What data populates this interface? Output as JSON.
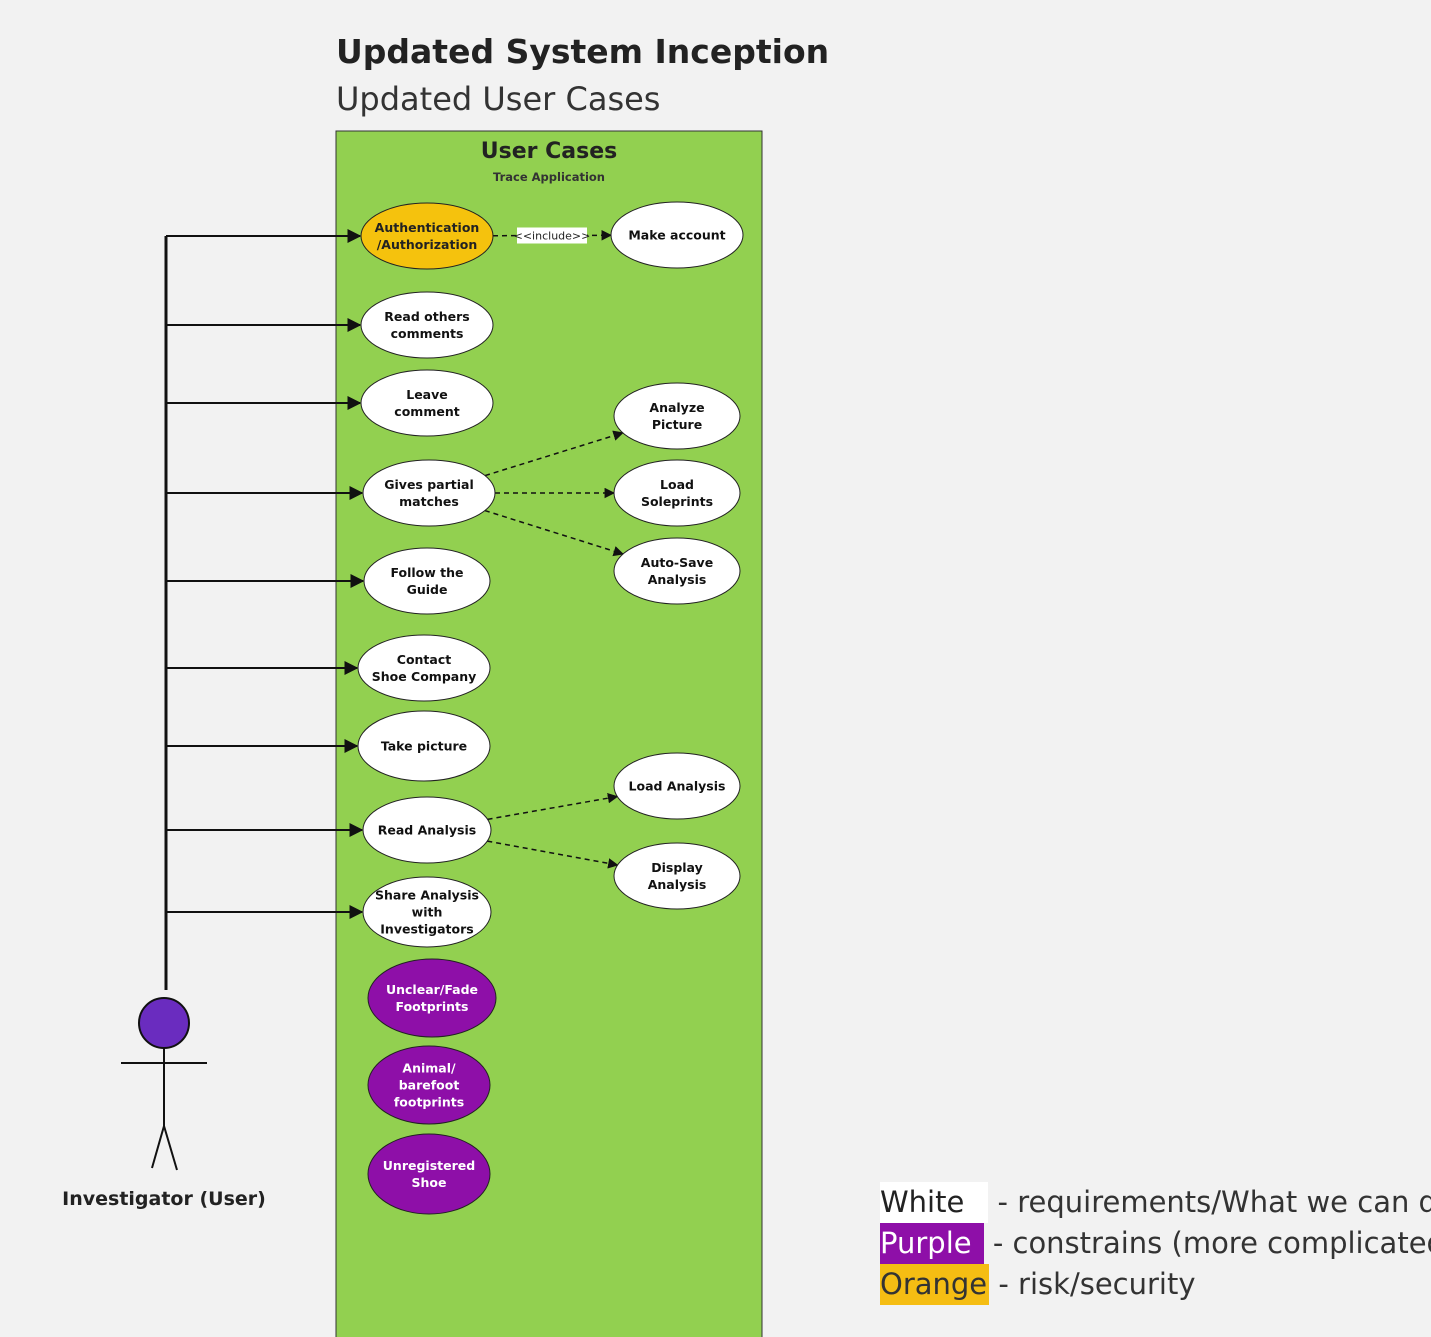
{
  "header": {
    "title": "Updated System Inception",
    "subtitle": "Updated User Cases"
  },
  "colors": {
    "background": "#f2f2f2",
    "system_boundary": "#92d050",
    "white_case": "#ffffff",
    "purple_case": "#8e0fa8",
    "orange_case": "#f5c20d",
    "actor_head": "#6a2cbf"
  },
  "system": {
    "title": "User Cases",
    "subtitle": "Trace Application"
  },
  "actor": {
    "label": "Investigator (User)",
    "icon": "stick-figure-icon"
  },
  "use_cases": [
    {
      "id": "auth",
      "lines": [
        "Authentication",
        "/Authorization"
      ],
      "color": "orange"
    },
    {
      "id": "make_account",
      "lines": [
        "Make account"
      ],
      "color": "white"
    },
    {
      "id": "read_comments",
      "lines": [
        "Read others",
        "comments"
      ],
      "color": "white"
    },
    {
      "id": "leave_comment",
      "lines": [
        "Leave",
        "comment"
      ],
      "color": "white"
    },
    {
      "id": "analyze_picture",
      "lines": [
        "Analyze",
        "Picture"
      ],
      "color": "white"
    },
    {
      "id": "partial_matches",
      "lines": [
        "Gives partial",
        "matches"
      ],
      "color": "white"
    },
    {
      "id": "load_soleprints",
      "lines": [
        "Load",
        "Soleprints"
      ],
      "color": "white"
    },
    {
      "id": "auto_save",
      "lines": [
        "Auto-Save",
        "Analysis"
      ],
      "color": "white"
    },
    {
      "id": "follow_guide",
      "lines": [
        "Follow the",
        "Guide"
      ],
      "color": "white"
    },
    {
      "id": "contact_company",
      "lines": [
        "Contact",
        "Shoe Company"
      ],
      "color": "white"
    },
    {
      "id": "take_picture",
      "lines": [
        "Take picture"
      ],
      "color": "white"
    },
    {
      "id": "load_analysis",
      "lines": [
        "Load Analysis"
      ],
      "color": "white"
    },
    {
      "id": "read_analysis",
      "lines": [
        "Read Analysis"
      ],
      "color": "white"
    },
    {
      "id": "display_analysis",
      "lines": [
        "Display",
        "Analysis"
      ],
      "color": "white"
    },
    {
      "id": "share_analysis",
      "lines": [
        "Share Analysis",
        "with",
        "Investigators"
      ],
      "color": "white"
    },
    {
      "id": "unclear_footprints",
      "lines": [
        "Unclear/Fade",
        "Footprints"
      ],
      "color": "purple"
    },
    {
      "id": "animal_footprints",
      "lines": [
        "Animal/",
        "barefoot",
        "footprints"
      ],
      "color": "purple"
    },
    {
      "id": "unregistered_shoe",
      "lines": [
        "Unregistered",
        "Shoe"
      ],
      "color": "purple"
    }
  ],
  "actor_links": [
    "auth",
    "read_comments",
    "leave_comment",
    "partial_matches",
    "follow_guide",
    "contact_company",
    "take_picture",
    "read_analysis",
    "share_analysis"
  ],
  "relations": [
    {
      "from": "auth",
      "to": "make_account",
      "style": "dashed",
      "label": "<<include>>"
    },
    {
      "from": "partial_matches",
      "to": "analyze_picture",
      "style": "dashed",
      "label": ""
    },
    {
      "from": "partial_matches",
      "to": "load_soleprints",
      "style": "dashed",
      "label": ""
    },
    {
      "from": "partial_matches",
      "to": "auto_save",
      "style": "dashed",
      "label": ""
    },
    {
      "from": "read_analysis",
      "to": "load_analysis",
      "style": "dashed",
      "label": ""
    },
    {
      "from": "read_analysis",
      "to": "display_analysis",
      "style": "dashed",
      "label": ""
    }
  ],
  "legend": [
    {
      "swatch": "White",
      "color": "white",
      "text": "- requirements/What we can do"
    },
    {
      "swatch": "Purple",
      "color": "purple",
      "text": "- constrains (more complicated)"
    },
    {
      "swatch": "Orange",
      "color": "orange",
      "text": "- risk/security"
    }
  ]
}
